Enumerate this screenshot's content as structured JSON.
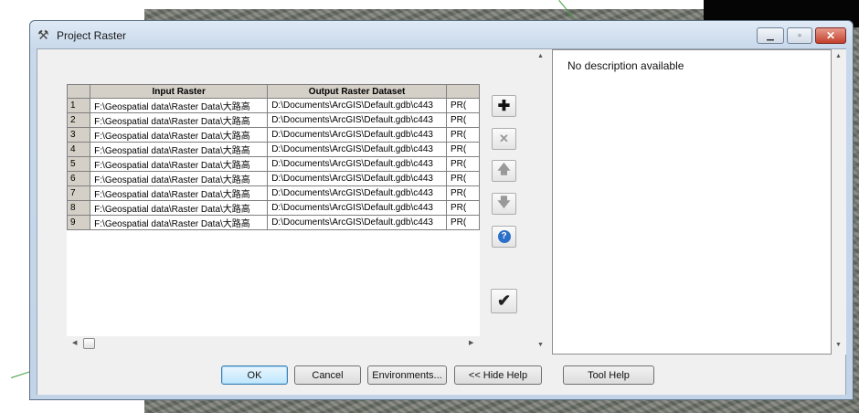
{
  "window": {
    "title": "Project Raster",
    "title_icon": "hammer-icon"
  },
  "grid": {
    "headers": [
      "Input Raster",
      "Output Raster Dataset",
      ""
    ],
    "rows": [
      {
        "num": "1",
        "input": "F:\\Geospatial data\\Raster Data\\大路高",
        "output": "D:\\Documents\\ArcGIS\\Default.gdb\\c443",
        "extra": "PR("
      },
      {
        "num": "2",
        "input": "F:\\Geospatial data\\Raster Data\\大路高",
        "output": "D:\\Documents\\ArcGIS\\Default.gdb\\c443",
        "extra": "PR("
      },
      {
        "num": "3",
        "input": "F:\\Geospatial data\\Raster Data\\大路高",
        "output": "D:\\Documents\\ArcGIS\\Default.gdb\\c443",
        "extra": "PR("
      },
      {
        "num": "4",
        "input": "F:\\Geospatial data\\Raster Data\\大路高",
        "output": "D:\\Documents\\ArcGIS\\Default.gdb\\c443",
        "extra": "PR("
      },
      {
        "num": "5",
        "input": "F:\\Geospatial data\\Raster Data\\大路高",
        "output": "D:\\Documents\\ArcGIS\\Default.gdb\\c443",
        "extra": "PR("
      },
      {
        "num": "6",
        "input": "F:\\Geospatial data\\Raster Data\\大路高",
        "output": "D:\\Documents\\ArcGIS\\Default.gdb\\c443",
        "extra": "PR("
      },
      {
        "num": "7",
        "input": "F:\\Geospatial data\\Raster Data\\大路高",
        "output": "D:\\Documents\\ArcGIS\\Default.gdb\\c443",
        "extra": "PR("
      },
      {
        "num": "8",
        "input": "F:\\Geospatial data\\Raster Data\\大路高",
        "output": "D:\\Documents\\ArcGIS\\Default.gdb\\c443",
        "extra": "PR("
      },
      {
        "num": "9",
        "input": "F:\\Geospatial data\\Raster Data\\大路高",
        "output": "D:\\Documents\\ArcGIS\\Default.gdb\\c443",
        "extra": "PR("
      }
    ]
  },
  "side_buttons": {
    "add": "✚",
    "remove": "✕",
    "up": "🡅",
    "down": "🡇",
    "help": "?",
    "check": "✔"
  },
  "help_pane": {
    "description": "No description available"
  },
  "buttons": {
    "ok": "OK",
    "cancel": "Cancel",
    "environments": "Environments...",
    "hide_help": "<< Hide Help",
    "tool_help": "Tool Help"
  },
  "colors": {
    "title_bg": "#c9d9eb",
    "close": "#c3402c",
    "grid_header": "#d4d0c8",
    "help_icon": "#2a6fc9"
  }
}
